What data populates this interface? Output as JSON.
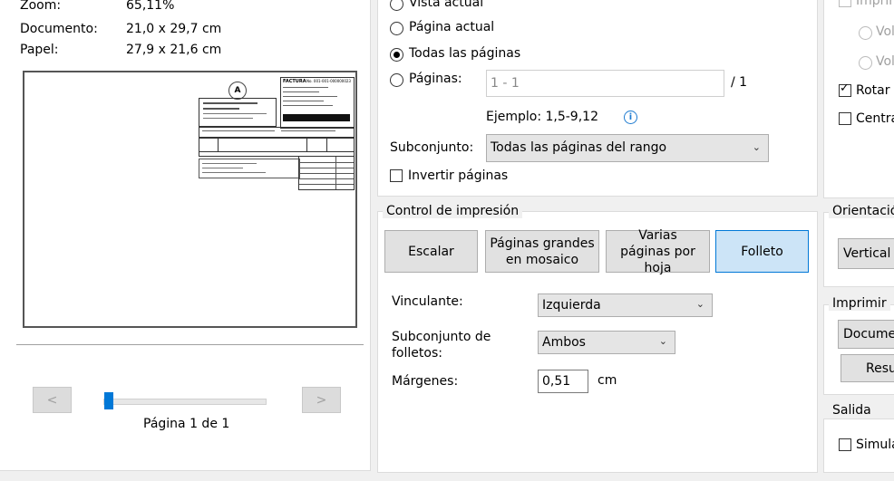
{
  "info": {
    "zoom_label": "Zoom:",
    "zoom_value": "65,11%",
    "doc_label": "Documento:",
    "doc_value": "21,0 x 29,7 cm",
    "paper_label": "Papel:",
    "paper_value": "27,9 x 21,6 cm"
  },
  "preview": {
    "factura_title": "FACTURA",
    "factura_no": "No. 001-001-000000023",
    "prev_label": "<",
    "next_label": ">",
    "page_indicator": "Página 1 de 1"
  },
  "range": {
    "vista_actual": "Vista actual",
    "pagina_actual": "Página actual",
    "todas": "Todas las páginas",
    "paginas_label": "Páginas:",
    "paginas_value": "1 - 1",
    "paginas_total": "/ 1",
    "example": "Ejemplo: 1,5-9,12",
    "subset_label": "Subconjunto:",
    "subset_value": "Todas las páginas del rango",
    "invert_label": "Invertir páginas",
    "selected": "todas"
  },
  "control": {
    "title": "Control de impresión",
    "btn_escalar": "Escalar",
    "btn_paginas_grandes": "Páginas grandes en mosaico",
    "btn_varias": "Varias páginas por hoja",
    "btn_folleto": "Folleto",
    "vinculante_label": "Vinculante:",
    "vinculante_value": "Izquierda",
    "subconjunto_label": "Subconjunto de folletos:",
    "subconjunto_value": "Ambos",
    "margenes_label": "Márgenes:",
    "margenes_value": "0,51",
    "margenes_unit": "cm"
  },
  "right": {
    "imprim_label": "Imprim",
    "vol1": "Vol",
    "vol2": "Vol",
    "rotar": "Rotar a",
    "centra": "Centra",
    "orientacion_title": "Orientación",
    "vertical": "Vertical",
    "imprimir_title": "Imprimir",
    "documen": "Documen",
    "resu": "Resu",
    "salida_title": "Salida",
    "simula": "Simula"
  }
}
